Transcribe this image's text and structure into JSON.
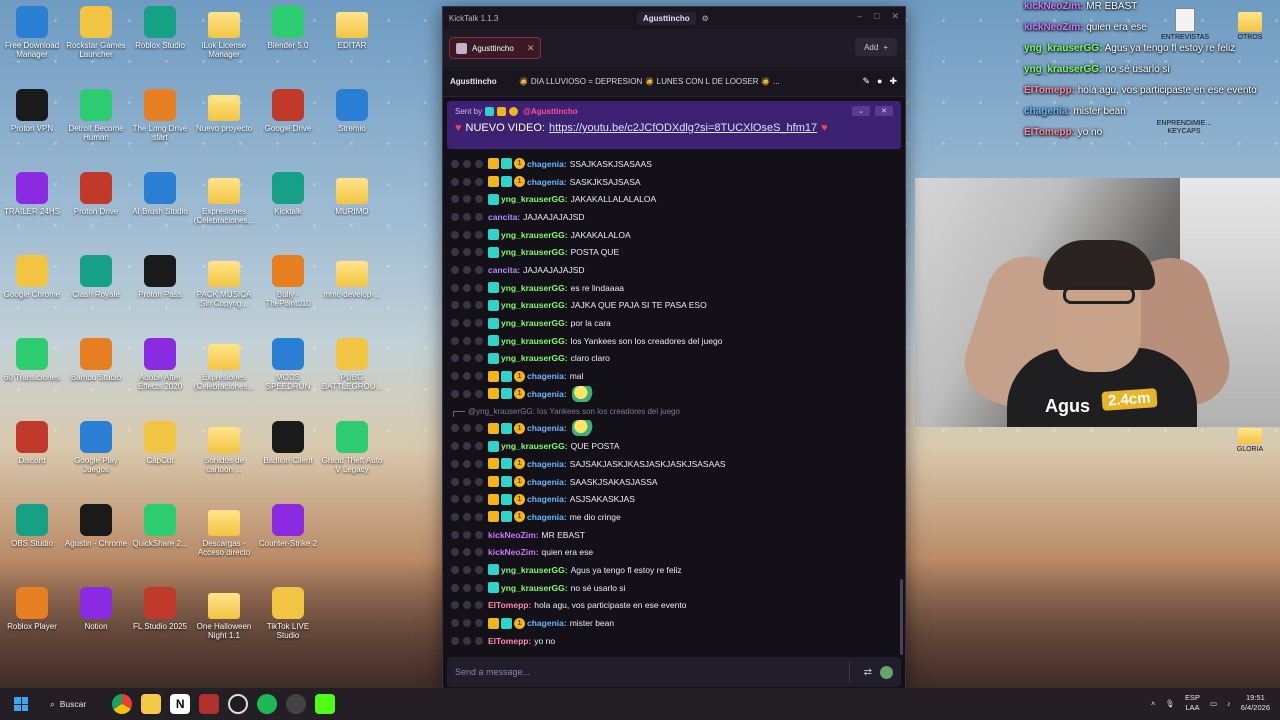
{
  "desktop": {
    "icons_col1": [
      "Free Download Manager",
      "Proton VPN",
      "TRAILER 24HS",
      "Google Chrome",
      "60 Transiciones",
      "Discord",
      "OBS Studio",
      "Roblox Player"
    ],
    "icons_col2": [
      "Rockstar Games Launcher",
      "Detroit Become Human",
      "Proton Drive",
      "Clash Royale",
      "Bambu Studio",
      "Google Play Juegos",
      "Agustin - Chrome",
      "Notion"
    ],
    "icons_col3": [
      "Roblox Studio",
      "The Long Drive start",
      "AI Brush Studio",
      "Proton Pass",
      "Adobe After Effects 2020",
      "CapCut",
      "QuickShare 2...",
      "FL Studio 2025"
    ],
    "icons_col4": [
      "iLok License Manager",
      "Nuevo proyecto",
      "Expresiones (Celebraciones...",
      "PACK MUSICA Sin Copyrig...",
      "Expresiones (Celebraciones...",
      "Sonidos de cartoon ...",
      "Descargas - Acceso directo",
      "One Halloween Night 1.1"
    ],
    "icons_col5": [
      "Blender 5.0",
      "Google Drive",
      "Kicktalk",
      "Bully - ThePoint010",
      "MODS SPEEDRUN",
      "Badlion Client",
      "Counter-Strike 2",
      "TikTok LIVE Studio"
    ],
    "icons_col6": [
      "EDITAR",
      "Stremio",
      "MURIMO",
      "mmc-develop-...",
      "PUBG BATTLEGROU...",
      "Grand Theft Auto V Legacy"
    ],
    "right_icons": [
      "ENTREVISTAS",
      "PERSONAJES",
      "OTROS",
      "ENPRENDIMIE... KEYCAPS",
      "GLORIA"
    ]
  },
  "overlay_chat": [
    {
      "user": "kickNeoZim:",
      "text": " MR EBAST",
      "color": "purple"
    },
    {
      "user": "kickNeoZim:",
      "text": " quien era ese",
      "color": "purple"
    },
    {
      "user": "yng_krauserGG:",
      "text": " Agus ya tengo fl estoy re feliz",
      "color": "green"
    },
    {
      "user": "yng_krauserGG:",
      "text": " no sé usarlo si",
      "color": "green"
    },
    {
      "user": "ElTomepp:",
      "text": " hola agu, vos participaste en ese evento",
      "color": "pink"
    },
    {
      "user": "chagenia:",
      "text": " mister bean",
      "color": "blue"
    },
    {
      "user": "ElTomepp:",
      "text": " yo no",
      "color": "pink"
    }
  ],
  "webcam": {
    "shirt_text": "Agus",
    "badge": "2.4cm"
  },
  "kicktalk": {
    "app_title": "KickTalk 1.1.3",
    "active_user": "Agusttincho",
    "tab_label": "Agusttincho",
    "add_label": "Add",
    "channel": "Agusttincho",
    "stream_title": "🧔 DIA LLUVIOSO = DEPRESION 🧔 LUNES CON L DE LOOSER 🧔 ...",
    "pinned": {
      "sent_by": "Sent by",
      "sender": "@Agusttincho",
      "text": "NUEVO VIDEO:",
      "link": "https://youtu.be/c2JCfODXdlg?si=8TUCXlOseS_hfm17"
    },
    "messages": [
      {
        "user": "chagenia:",
        "text": "SSAJKASKJSASAAS",
        "color": "#66b8ff",
        "badges": [
          "sub",
          "vip",
          "num"
        ]
      },
      {
        "user": "chagenia:",
        "text": "SASKJKSAJSASA",
        "color": "#66b8ff",
        "badges": [
          "sub",
          "vip",
          "num"
        ]
      },
      {
        "user": "yng_krauserGG:",
        "text": "JAKAKALLALALALOA",
        "color": "#7cff68",
        "badges": [
          "vip"
        ]
      },
      {
        "user": "cancita:",
        "text": "JAJAAJAJAJSD",
        "color": "#b28cff",
        "badges": []
      },
      {
        "user": "yng_krauserGG:",
        "text": "JAKAKALALOA",
        "color": "#7cff68",
        "badges": [
          "vip"
        ]
      },
      {
        "user": "yng_krauserGG:",
        "text": "POSTA QUE",
        "color": "#7cff68",
        "badges": [
          "vip"
        ]
      },
      {
        "user": "cancita:",
        "text": "JAJAAJAJAJSD",
        "color": "#b28cff",
        "badges": []
      },
      {
        "user": "yng_krauserGG:",
        "text": "es re lindaaaa",
        "color": "#7cff68",
        "badges": [
          "vip"
        ]
      },
      {
        "user": "yng_krauserGG:",
        "text": "JAJKA QUE PAJA SI TE PASA ESO",
        "color": "#7cff68",
        "badges": [
          "vip"
        ]
      },
      {
        "user": "yng_krauserGG:",
        "text": "por la cara",
        "color": "#7cff68",
        "badges": [
          "vip"
        ]
      },
      {
        "user": "yng_krauserGG:",
        "text": "los Yankees son los creadores del juego",
        "color": "#7cff68",
        "badges": [
          "vip"
        ]
      },
      {
        "user": "yng_krauserGG:",
        "text": "claro claro",
        "color": "#7cff68",
        "badges": [
          "vip"
        ]
      },
      {
        "user": "chagenia:",
        "text": "mal",
        "color": "#66b8ff",
        "badges": [
          "sub",
          "vip",
          "num"
        ]
      },
      {
        "user": "chagenia:",
        "text": "",
        "color": "#66b8ff",
        "badges": [
          "sub",
          "vip",
          "num"
        ],
        "emote": true
      },
      {
        "reply": "@yng_krauserGG: los Yankees son los creadores del juego"
      },
      {
        "user": "chagenia:",
        "text": "",
        "color": "#66b8ff",
        "badges": [
          "sub",
          "vip",
          "num"
        ],
        "emote": true
      },
      {
        "user": "yng_krauserGG:",
        "text": "QUE POSTA",
        "color": "#7cff68",
        "badges": [
          "vip"
        ]
      },
      {
        "user": "chagenia:",
        "text": "SAJSAKJASKJKASJASKJASKJSASAAS",
        "color": "#66b8ff",
        "badges": [
          "sub",
          "vip",
          "num"
        ]
      },
      {
        "user": "chagenia:",
        "text": "SAASKJSAKASJASSA",
        "color": "#66b8ff",
        "badges": [
          "sub",
          "vip",
          "num"
        ]
      },
      {
        "user": "chagenia:",
        "text": "ASJSAKASKJAS",
        "color": "#66b8ff",
        "badges": [
          "sub",
          "vip",
          "num"
        ]
      },
      {
        "user": "chagenia:",
        "text": "me dio cringe",
        "color": "#66b8ff",
        "badges": [
          "sub",
          "vip",
          "num"
        ]
      },
      {
        "user": "kickNeoZim:",
        "text": "MR EBAST",
        "color": "#c978ff",
        "badges": []
      },
      {
        "user": "kickNeoZim:",
        "text": "quien era ese",
        "color": "#c978ff",
        "badges": []
      },
      {
        "user": "yng_krauserGG:",
        "text": "Agus ya tengo fl estoy re feliz",
        "color": "#7cff68",
        "badges": [
          "vip"
        ]
      },
      {
        "user": "yng_krauserGG:",
        "text": "no sé usarlo si",
        "color": "#7cff68",
        "badges": [
          "vip"
        ]
      },
      {
        "user": "ElTomepp:",
        "text": "hola agu, vos participaste en ese evento",
        "color": "#ff8aa8",
        "badges": []
      },
      {
        "user": "chagenia:",
        "text": "mister bean",
        "color": "#66b8ff",
        "badges": [
          "sub",
          "vip",
          "num"
        ]
      },
      {
        "user": "ElTomepp:",
        "text": "yo no",
        "color": "#ff8aa8",
        "badges": []
      }
    ],
    "input_placeholder": "Send a message..."
  },
  "taskbar": {
    "search": "Buscar",
    "lang1": "ESP",
    "lang2": "LAA",
    "time": "19:51",
    "date": "6/4/2026"
  }
}
